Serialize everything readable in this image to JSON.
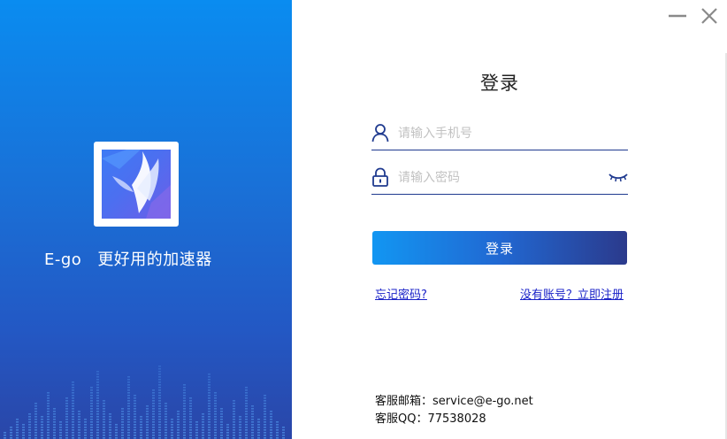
{
  "branding": {
    "app_name": "E-go",
    "slogan": "更好用的加速器",
    "colors": {
      "gradient_top": "#0a8cf0",
      "gradient_bottom": "#2a46a8"
    }
  },
  "window": {
    "minimize_icon": "minimize-icon",
    "close_icon": "close-icon"
  },
  "login": {
    "title": "登录",
    "phone_placeholder": "请输入手机号",
    "phone_value": "",
    "phone_icon": "user-icon",
    "password_placeholder": "请输入密码",
    "password_value": "",
    "password_icon": "lock-icon",
    "password_toggle_icon": "eye-closed-icon",
    "submit_label": "登录",
    "forgot_password_link": "忘记密码?",
    "register_link": "没有账号？立即注册",
    "colors": {
      "button_start": "#1296f2",
      "button_end": "#2b3a8c",
      "link": "#1a22c8"
    }
  },
  "contact": {
    "email_label": "客服邮箱：",
    "email": "service@e-go.net",
    "qq_label": "客服QQ：",
    "qq": "77538028"
  }
}
